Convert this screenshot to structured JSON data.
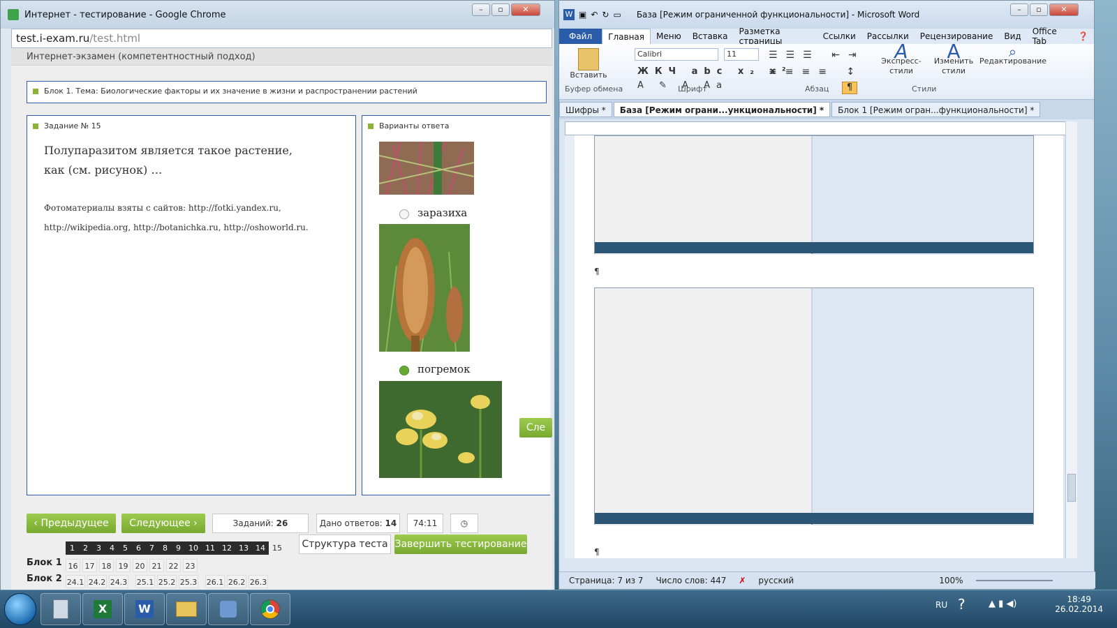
{
  "chrome": {
    "title": "Интернет - тестирование - Google Chrome",
    "url_host": "test.i-exam.ru",
    "url_path": "/test.html",
    "page_header": "Интернет-экзамен (компетентностный подход)",
    "block_title": "Блок 1. Тема: Биологические факторы и их значение в жизни и распространении растений",
    "task_title": "Задание № 15",
    "question": "Полупаразитом является такое растение, как (см. рисунок) …",
    "note": "Фотоматериалы взяты с сайтов: http://fotki.yandex.ru, http://wikipedia.org, http://botanichka.ru, http://oshoworld.ru.",
    "answers_title": "Варианты ответа",
    "options": [
      {
        "label": "заразиха",
        "selected": false
      },
      {
        "label": "погремок",
        "selected": true
      }
    ],
    "next_side_button": "Сле",
    "prev_button": "Предыдущее",
    "next_button": "Следующее",
    "tasks_label": "Заданий:",
    "tasks_count": "26",
    "answers_label": "Дано ответов:",
    "answers_count": "14",
    "timer": "74:11",
    "structure_button": "Структура теста",
    "finish_button": "Завершить тестирование",
    "block1_label": "Блок 1",
    "block2_label": "Блок 2",
    "dark_nums": [
      "1",
      "2",
      "3",
      "4",
      "5",
      "6",
      "7",
      "8",
      "9",
      "10",
      "11",
      "12",
      "13",
      "14"
    ],
    "current_num": "15",
    "block1_nums": [
      "16",
      "17",
      "18",
      "19",
      "20",
      "21",
      "22",
      "23"
    ],
    "block2_nums": [
      "24.1",
      "24.2",
      "24.3",
      "25.1",
      "25.2",
      "25.3",
      "26.1",
      "26.2",
      "26.3"
    ]
  },
  "word": {
    "title": "База [Режим ограниченной функциональности] - Microsoft Word",
    "menu": [
      "Файл",
      "Главная",
      "Меню",
      "Вставка",
      "Разметка страницы",
      "Ссылки",
      "Рассылки",
      "Рецензирование",
      "Вид",
      "Office Tab"
    ],
    "font_name": "Calibri",
    "font_size": "11",
    "paste_label": "Вставить",
    "styles_label": "Экспресс-стили",
    "change_styles_label": "Изменить стили",
    "editing_label": "Редактирование",
    "group_clipboard": "Буфер обмена",
    "group_font": "Шрифт",
    "group_paragraph": "Абзац",
    "group_styles": "Стили",
    "tabs": [
      "Шифры *",
      "База [Режим ограни...ункциональности] *",
      "Блок 1 [Режим огран...функциональности] *"
    ],
    "status_page": "Страница: 7 из 7",
    "status_words": "Число слов: 447",
    "status_lang": "русский",
    "zoom": "100%",
    "para_mark": "¶"
  },
  "taskbar": {
    "lang": "RU",
    "time": "18:49",
    "date": "26.02.2014"
  },
  "colors": {
    "accent_green": "#8ab534",
    "selected_green": "#66aa33",
    "word_blue": "#2a5caa"
  }
}
